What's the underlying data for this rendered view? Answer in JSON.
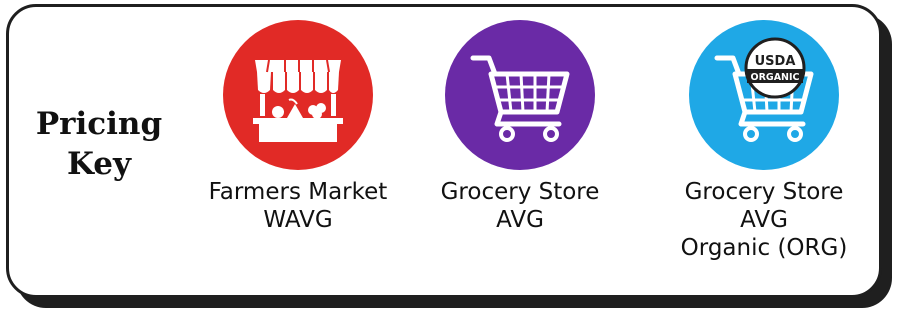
{
  "key_title": [
    "Pricing",
    "Key"
  ],
  "items": [
    {
      "icon": "farmers-market-stall-icon",
      "color": "#e12a26",
      "lines": [
        "Farmers Market",
        "WAVG"
      ]
    },
    {
      "icon": "shopping-cart-icon",
      "color": "#6a2aa6",
      "lines": [
        "Grocery Store",
        "AVG"
      ]
    },
    {
      "icon": "usda-organic-cart-icon",
      "color": "#1fa8e6",
      "lines": [
        "Grocery Store",
        "AVG",
        "Organic (ORG)"
      ],
      "seal_text": [
        "USDA",
        "ORGANIC"
      ]
    }
  ]
}
